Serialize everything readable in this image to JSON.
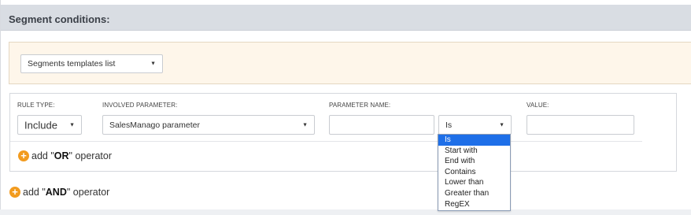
{
  "header": {
    "title": "Segment conditions:"
  },
  "templates": {
    "select_value": "Segments templates list"
  },
  "rule": {
    "labels": {
      "rule_type": "RULE TYPE:",
      "involved_parameter": "INVOLVED PARAMETER:",
      "parameter_name": "PARAMETER NAME:",
      "value": "VALUE:"
    },
    "rule_type_value": "Include",
    "involved_parameter_value": "SalesManago parameter",
    "parameter_name_value": "",
    "operator_value": "Is",
    "value_value": "",
    "or_link": {
      "prefix": "add \"",
      "keyword": "OR",
      "suffix": "\" operator"
    }
  },
  "and_link": {
    "prefix": "add \"",
    "keyword": "AND",
    "suffix": "\" operator"
  },
  "operator_options": [
    "Is",
    "Start with",
    "End with",
    "Contains",
    "Lower than",
    "Greater than",
    "RegEX"
  ],
  "colors": {
    "accent_orange": "#f29b1e",
    "selected_blue": "#1e6fe8",
    "header_bg": "#d9dde3",
    "templates_bg": "#fef6ea"
  },
  "icons": {
    "add": "plus-circle-icon",
    "caret": "caret-down-icon"
  }
}
